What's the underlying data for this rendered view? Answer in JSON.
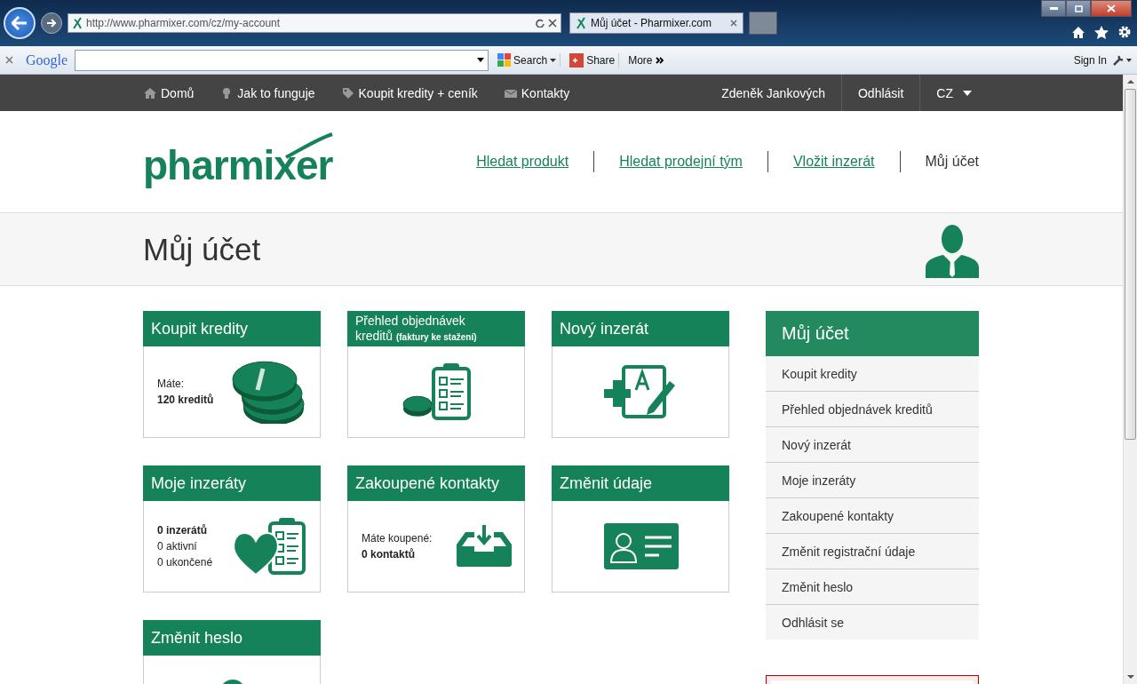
{
  "browser": {
    "address": "http://www.pharmixer.com/cz/my-account",
    "tab_title": "Můj účet - Pharmixer.com",
    "google_logo": "Google",
    "search_button": "Search",
    "share_button": "Share",
    "more_button": "More",
    "sign_in": "Sign In"
  },
  "topbar": {
    "links": [
      {
        "label": "Domů",
        "kind": "home"
      },
      {
        "label": "Jak to funguje",
        "kind": "bulb"
      },
      {
        "label": "Koupit kredity + ceník",
        "kind": "tag"
      },
      {
        "label": "Kontakty",
        "kind": "mail"
      }
    ],
    "user": "Zdeněk Jankových",
    "logout": "Odhlásit",
    "language": "CZ"
  },
  "header": {
    "logo": "pharmixer",
    "nav": [
      {
        "label": "Hledat produkt",
        "selected": false
      },
      {
        "label": "Hledat prodejní tým",
        "selected": false
      },
      {
        "label": "Vložit inzerát",
        "selected": false
      },
      {
        "label": "Můj účet",
        "selected": true
      }
    ]
  },
  "page_title": "Můj účet",
  "cards": [
    {
      "title": "Koupit kredity",
      "kind": "coins",
      "lines": [
        {
          "text": "Máte:",
          "bold": false
        },
        {
          "text": "120 kreditů",
          "bold": true
        }
      ]
    },
    {
      "title": "Přehled objednávek kreditů **(faktury ke stažení)**",
      "kind": "orders"
    },
    {
      "title": "Nový inzerát",
      "kind": "new-ad"
    },
    {
      "title": "Moje inzeráty",
      "kind": "my-ads",
      "lines": [
        {
          "text": "0 inzerátů",
          "bold": true
        },
        {
          "text": "0 aktivní",
          "bold": false
        },
        {
          "text": "0 ukončené",
          "bold": false
        }
      ]
    },
    {
      "title": "Zakoupené kontakty",
      "kind": "contacts",
      "lines": [
        {
          "text": "Máte koupené:",
          "bold": false
        },
        {
          "text": "0 kontaktů",
          "bold": true
        }
      ]
    },
    {
      "title": "Změnit údaje",
      "kind": "profile"
    },
    {
      "title": "Změnit heslo",
      "kind": "password"
    }
  ],
  "sidebar": {
    "title": "Můj účet",
    "items": [
      "Koupit kredity",
      "Přehled objednávek kreditů",
      "Nový inzerát",
      "Moje inzeráty",
      "Zakoupené kontakty",
      "Změnit registrační údaje",
      "Změnit heslo",
      "Odhlásit se"
    ]
  }
}
